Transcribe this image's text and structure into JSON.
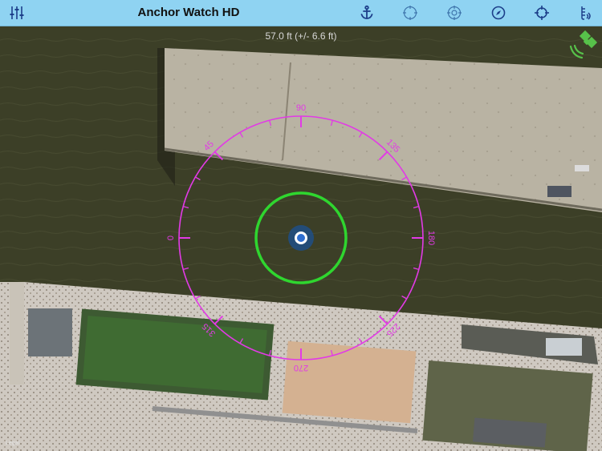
{
  "app": {
    "title": "Anchor Watch HD"
  },
  "toolbar": {
    "left_icon": "settings-sliders-icon",
    "right_icons": [
      "anchor-icon",
      "anchor-target-icon",
      "crosshair-circle-icon",
      "compass-icon",
      "locate-crosshair-icon",
      "depth-sounder-icon"
    ]
  },
  "map": {
    "distance_readout": "57.0 ft (+/- 6.6 ft)",
    "legal_label": "Legal",
    "compass_labels": [
      "90",
      "135",
      "180",
      "225",
      "270",
      "315",
      "0",
      "45"
    ],
    "gps_status_icon": "satellite-icon"
  },
  "colors": {
    "toolbar_bg": "#8fd3f2",
    "compass_ring": "#e23ae6",
    "alarm_circle": "#2fd62f",
    "boat_marker": "#2f6fd0",
    "water": "#3c3f27",
    "gps_icon": "#57c24a"
  }
}
